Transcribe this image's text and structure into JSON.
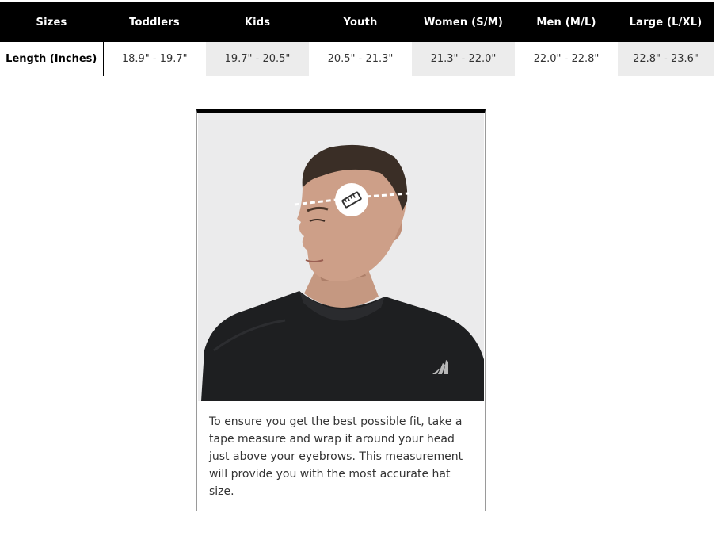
{
  "size_chart": {
    "headers": [
      "Sizes",
      "Toddlers",
      "Kids",
      "Youth",
      "Women (S/M)",
      "Men (M/L)",
      "Large (L/XL)"
    ],
    "row_label": "Length (Inches)",
    "values": [
      "18.9\" - 19.7\"",
      "19.7\" - 20.5\"",
      "20.5\" - 21.3\"",
      "21.3\" - 22.0\"",
      "22.0\" - 22.8\"",
      "22.8\" - 23.6\""
    ]
  },
  "measure_card": {
    "instructions": "To ensure you get the best possible fit, take a tape measure and wrap it around your head just above your eyebrows. This measurement will provide you with the most accurate hat size.",
    "icon": "ruler-icon"
  },
  "colors": {
    "header_bg": "#000000",
    "shaded_cell": "#ececec",
    "photo_bg": "#ebebec"
  }
}
